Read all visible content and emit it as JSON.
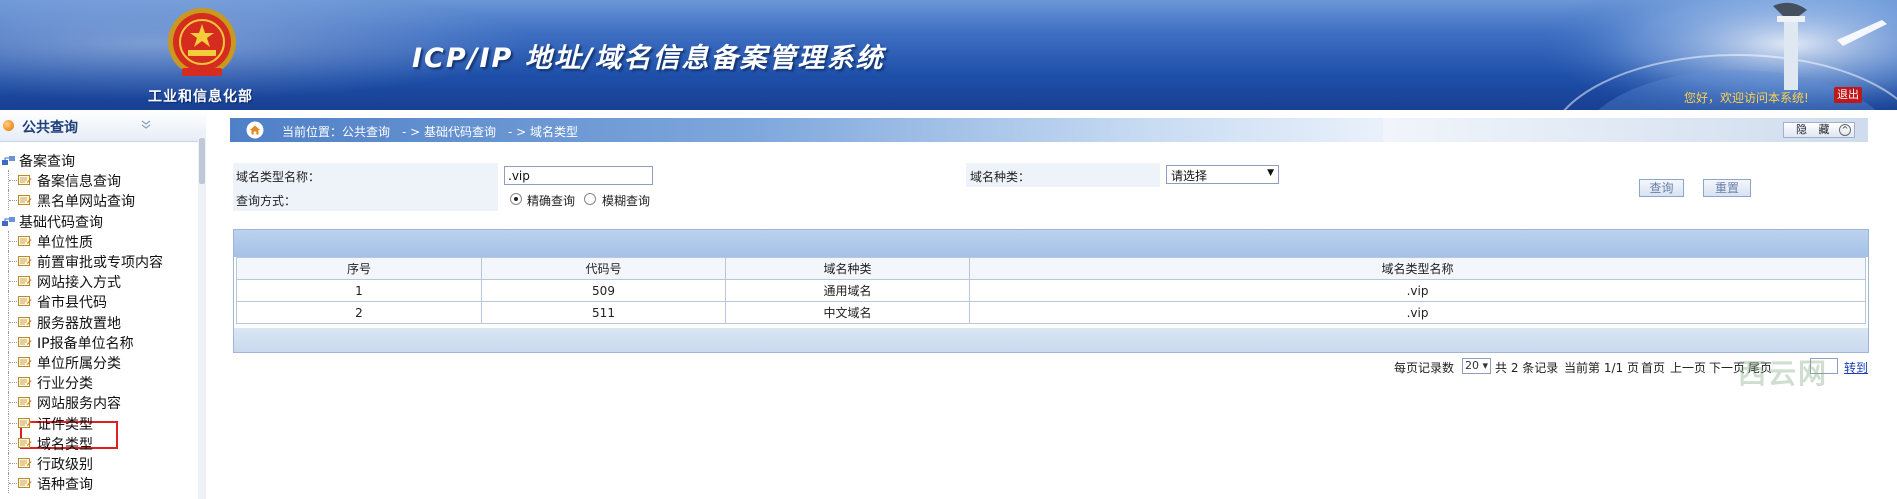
{
  "header": {
    "ministry_name": "工业和信息化部",
    "system_title": "ICP/IP 地址/域名信息备案管理系统",
    "welcome": "您好，欢迎访问本系统!",
    "logout": "退出",
    "colors": {
      "primary": "#1e4fa8",
      "welcome": "#ffd24a",
      "logout_bg": "#c0171a"
    }
  },
  "sidebar": {
    "title": "公共查询",
    "groups": [
      {
        "label": "备案查询",
        "items": [
          "备案信息查询",
          "黑名单网站查询"
        ]
      },
      {
        "label": "基础代码查询",
        "items": [
          "单位性质",
          "前置审批或专项内容",
          "网站接入方式",
          "省市县代码",
          "服务器放置地",
          "IP报备单位名称",
          "单位所属分类",
          "行业分类",
          "网站服务内容",
          "证件类型",
          "域名类型",
          "行政级别",
          "语种查询"
        ]
      }
    ],
    "selected": "域名类型"
  },
  "breadcrumb": {
    "text": "当前位置：公共查询　- > 基础代码查询　- > 域名类型",
    "hide_label": "隐 藏"
  },
  "query": {
    "name_label": "域名类型名称：",
    "name_value": ".vip",
    "mode_label": "查询方式：",
    "mode_exact": "精确查询",
    "mode_fuzzy": "模糊查询",
    "kind_label": "域名种类：",
    "kind_value": "请选择",
    "search_button": "查询",
    "reset_button": "重置"
  },
  "table": {
    "columns": [
      "序号",
      "代码号",
      "域名种类",
      "域名类型名称"
    ],
    "rows": [
      [
        "1",
        "509",
        "通用域名",
        ".vip"
      ],
      [
        "2",
        "511",
        "中文域名",
        ".vip"
      ]
    ]
  },
  "pager": {
    "per_page_label": "每页记录数",
    "per_page_value": "20",
    "total": "共 2 条记录",
    "current": "当前第 1/1 页",
    "first": "首页",
    "prev": "上一页",
    "next": "下一页",
    "last": "尾页",
    "go": "转到"
  },
  "watermark": "西云网"
}
